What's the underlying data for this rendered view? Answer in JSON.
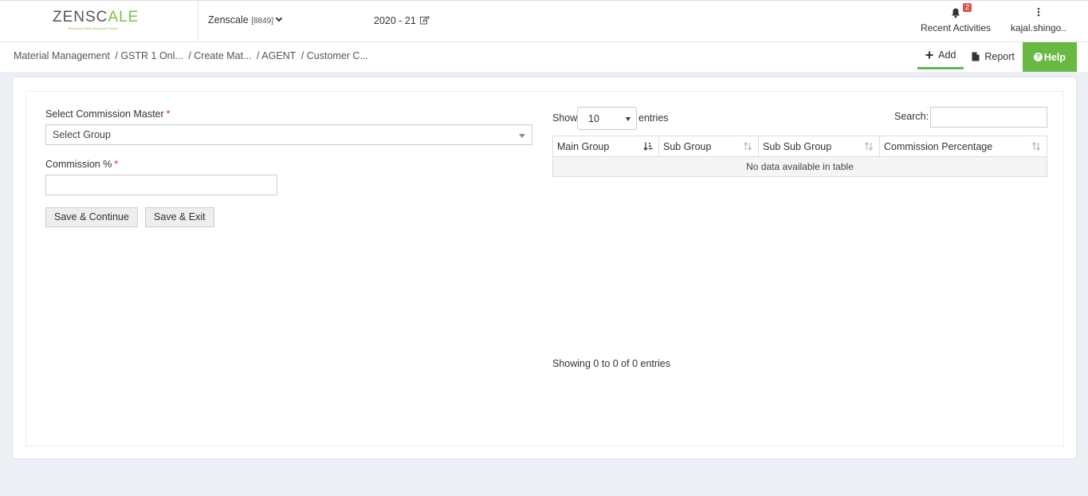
{
  "header": {
    "logo_dark": "ZENSC",
    "logo_green": "ALE",
    "logo_tagline": "Business Ease Business Peace.",
    "company_name": "Zenscale",
    "company_code": "[8849]",
    "financial_year": "2020 - 21",
    "notifications_count": "2",
    "recent_label": "Recent Activities",
    "user_label": "kajal.shingo.."
  },
  "breadcrumb": {
    "items": [
      "Material Management",
      "/ GSTR 1 Onl...",
      "/ Create Mat...",
      "/ AGENT",
      "/ Customer C..."
    ]
  },
  "actions": {
    "add_label": "Add",
    "report_label": "Report",
    "help_label": "Help"
  },
  "form": {
    "commission_master_label": "Select Commission Master",
    "commission_master_value": "Select Group",
    "commission_pct_label": "Commission %",
    "commission_pct_value": "",
    "required_mark": "*",
    "save_continue_label": "Save & Continue",
    "save_exit_label": "Save & Exit"
  },
  "table": {
    "show_label": "Show",
    "page_length": "10",
    "entries_label": "entries",
    "search_label": "Search:",
    "columns": [
      "Main Group",
      "Sub Group",
      "Sub Sub Group",
      "Commission Percentage"
    ],
    "empty_text": "No data available in table",
    "info_text": "Showing 0 to 0 of 0 entries"
  },
  "colors": {
    "accent_green": "#69b843",
    "badge_red": "#d9534f",
    "required_red": "#d9232e"
  }
}
